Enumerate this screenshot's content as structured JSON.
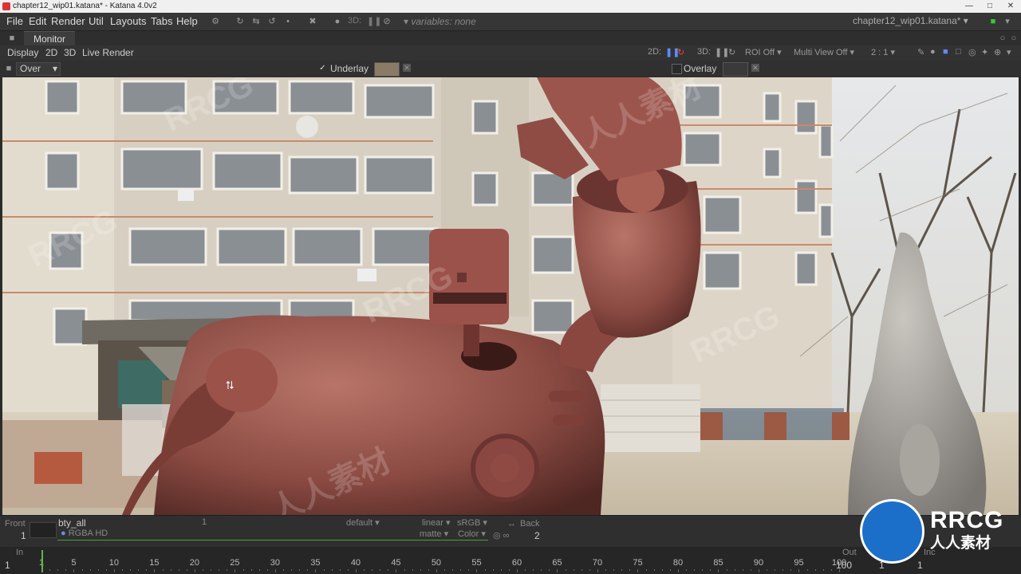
{
  "window": {
    "title": "chapter12_wip01.katana* - Katana 4.0v2"
  },
  "menubar": {
    "items": [
      "File",
      "Edit",
      "Render",
      "Util",
      "Layouts",
      "Tabs",
      "Help"
    ],
    "mode3d": "3D:",
    "variables": "variables: none",
    "project": "chapter12_wip01.katana*"
  },
  "panel": {
    "tab": "Monitor"
  },
  "monitor_toolbar": {
    "left_items": [
      "Display",
      "2D",
      "3D",
      "Live Render"
    ],
    "label_2d": "2D:",
    "label_3d": "3D:",
    "roi": "ROI Off",
    "multiview": "Multi View Off",
    "ratio": "2 : 1"
  },
  "overlay_bar": {
    "composite_mode": "Over",
    "underlay_label": "Underlay",
    "underlay_checked": "✓",
    "overlay_label": "Overlay"
  },
  "image_info": {
    "view": "Front",
    "view_num": "1",
    "pass": "bty_all",
    "format": "RGBA HD",
    "frame": "1",
    "lut": "default",
    "colorspace": "linear",
    "display": "sRGB",
    "alpha": "matte",
    "channel": "Color",
    "back": "Back",
    "back_num": "2"
  },
  "timeline": {
    "in_label": "In",
    "in_value": "1",
    "out_label": "Out",
    "out_value": "100",
    "current": "1",
    "inc_label": "Inc",
    "inc_value": "1",
    "ticks": [
      "1",
      "5",
      "10",
      "15",
      "20",
      "25",
      "30",
      "35",
      "40",
      "45",
      "50",
      "55",
      "60",
      "65",
      "70",
      "75",
      "80",
      "85",
      "90",
      "95",
      "100"
    ]
  },
  "watermark": {
    "logo_text": "RRCG",
    "logo_sub": "人人素材"
  }
}
